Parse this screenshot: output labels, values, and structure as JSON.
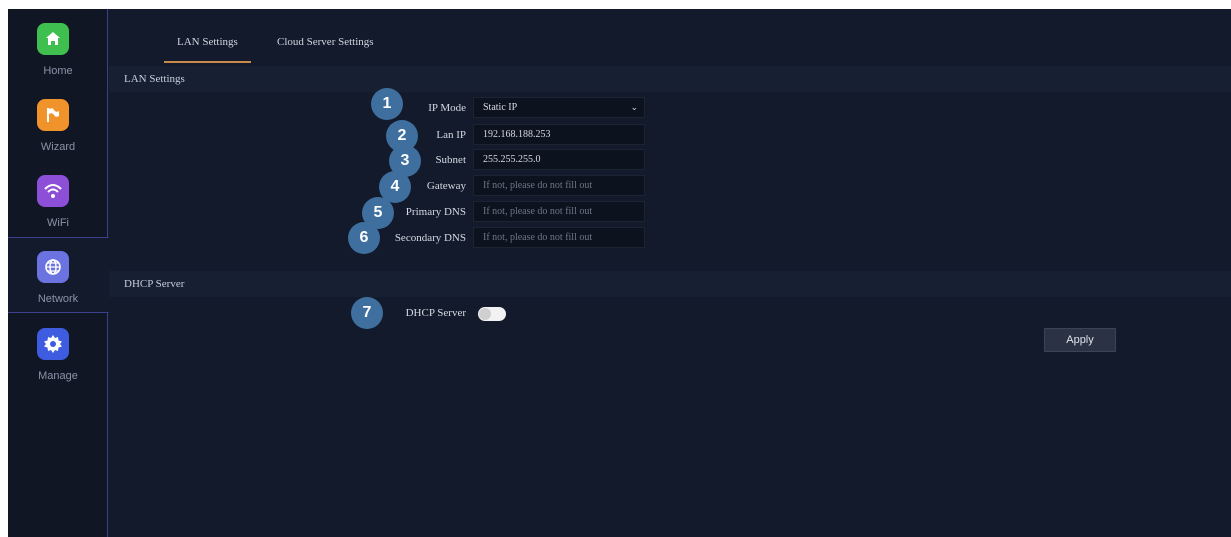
{
  "sidebar": {
    "items": [
      {
        "label": "Home"
      },
      {
        "label": "Wizard"
      },
      {
        "label": "WiFi"
      },
      {
        "label": "Network"
      },
      {
        "label": "Manage"
      }
    ]
  },
  "tabs": [
    {
      "label": "LAN Settings"
    },
    {
      "label": "Cloud Server Settings"
    }
  ],
  "lan_section": {
    "title": "LAN Settings",
    "fields": [
      {
        "badge": "1",
        "label": "IP Mode",
        "value": "Static IP"
      },
      {
        "badge": "2",
        "label": "Lan IP",
        "value": "192.168.188.253"
      },
      {
        "badge": "3",
        "label": "Subnet",
        "value": "255.255.255.0"
      },
      {
        "badge": "4",
        "label": "Gateway",
        "placeholder": "If not, please do not fill out"
      },
      {
        "badge": "5",
        "label": "Primary DNS",
        "placeholder": "If not, please do not fill out"
      },
      {
        "badge": "6",
        "label": "Secondary DNS",
        "placeholder": "If not, please do not fill out"
      }
    ]
  },
  "dhcp_section": {
    "title": "DHCP Server",
    "badge": "7",
    "label": "DHCP Server",
    "enabled": false
  },
  "apply_label": "Apply",
  "colors": {
    "background": "#121a2b",
    "sidebar": "#101624",
    "active_tab_underline": "#c9894a",
    "badge": "#3f6f9e",
    "home_icon": "#3fbf4f",
    "wizard_icon": "#f0932b",
    "wifi_icon": "#8e4fd8",
    "network_icon": "#6b73e0",
    "manage_icon": "#3d5ce0"
  },
  "icons": [
    "home-icon",
    "flag-icon",
    "wifi-icon",
    "globe-icon",
    "gear-icon",
    "chevron-down-icon"
  ]
}
